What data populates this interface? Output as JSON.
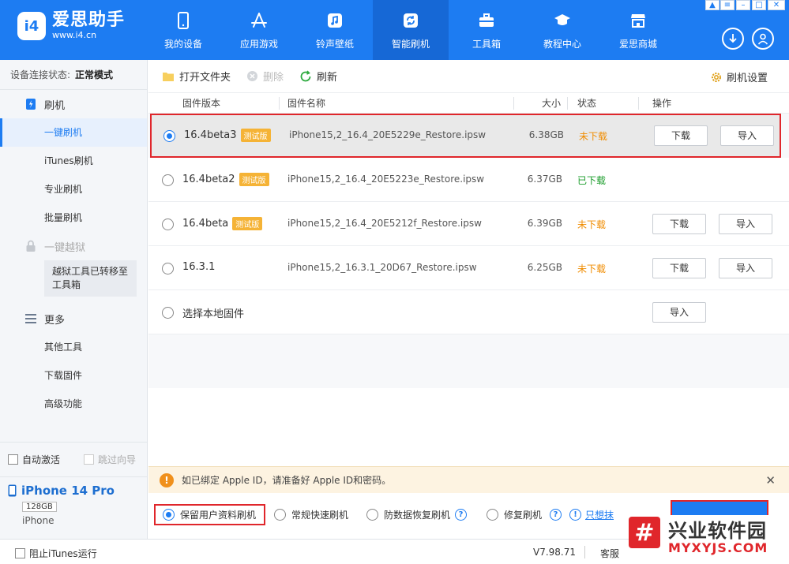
{
  "app": {
    "logo_mark": "i4",
    "logo_title": "爱思助手",
    "logo_url": "www.i4.cn"
  },
  "nav": [
    {
      "label": "我的设备",
      "icon": "phone-icon"
    },
    {
      "label": "应用游戏",
      "icon": "app-store-icon"
    },
    {
      "label": "铃声壁纸",
      "icon": "music-icon"
    },
    {
      "label": "智能刷机",
      "icon": "refresh-icon",
      "active": true
    },
    {
      "label": "工具箱",
      "icon": "toolbox-icon"
    },
    {
      "label": "教程中心",
      "icon": "graduation-cap-icon"
    },
    {
      "label": "爱思商城",
      "icon": "shop-icon"
    }
  ],
  "sidebar": {
    "conn_label": "设备连接状态:",
    "conn_value": "正常模式",
    "flash_section": "刷机",
    "items": [
      "一键刷机",
      "iTunes刷机",
      "专业刷机",
      "批量刷机"
    ],
    "jailbreak_section": "一键越狱",
    "jailbreak_note": "越狱工具已转移至工具箱",
    "more_section": "更多",
    "more_items": [
      "其他工具",
      "下载固件",
      "高级功能"
    ],
    "auto_activate": "自动激活",
    "skip_guide": "跳过向导"
  },
  "device": {
    "name": "iPhone 14 Pro",
    "capacity": "128GB",
    "type": "iPhone"
  },
  "toolbar": {
    "open_folder": "打开文件夹",
    "delete": "删除",
    "refresh": "刷新",
    "settings": "刷机设置"
  },
  "table": {
    "headers": {
      "version": "固件版本",
      "name": "固件名称",
      "size": "大小",
      "status": "状态",
      "action": "操作"
    },
    "rows": [
      {
        "version": "16.4beta3",
        "beta": "测试版",
        "name": "iPhone15,2_16.4_20E5229e_Restore.ipsw",
        "size": "6.38GB",
        "status": "未下载",
        "download": "下载",
        "import": "导入"
      },
      {
        "version": "16.4beta2",
        "beta": "测试版",
        "name": "iPhone15,2_16.4_20E5223e_Restore.ipsw",
        "size": "6.37GB",
        "status": "已下载"
      },
      {
        "version": "16.4beta",
        "beta": "测试版",
        "name": "iPhone15,2_16.4_20E5212f_Restore.ipsw",
        "size": "6.39GB",
        "status": "未下载",
        "download": "下载",
        "import": "导入"
      },
      {
        "version": "16.3.1",
        "name": "iPhone15,2_16.3.1_20D67_Restore.ipsw",
        "size": "6.25GB",
        "status": "未下载",
        "download": "下载",
        "import": "导入"
      }
    ],
    "local_label": "选择本地固件",
    "local_import": "导入"
  },
  "alert": {
    "icon": "!",
    "text": "如已绑定 Apple ID，请准备好 Apple ID和密码。"
  },
  "modes": {
    "keep_data": "保留用户资料刷机",
    "quick": "常规快速刷机",
    "anti_recovery": "防数据恢复刷机",
    "repair": "修复刷机",
    "link": "只想抹"
  },
  "statusbar": {
    "block_itunes": "阻止iTunes运行",
    "version": "V7.98.71",
    "service": "客服"
  },
  "watermark": {
    "mark": "#",
    "title": "兴业软件园",
    "url": "MYXYJS.COM"
  },
  "colors": {
    "brand": "#1d7cf2",
    "highlight_red": "#e0262b",
    "status_not_downloaded": "#f08c00",
    "status_downloaded": "#1a9c2a"
  }
}
